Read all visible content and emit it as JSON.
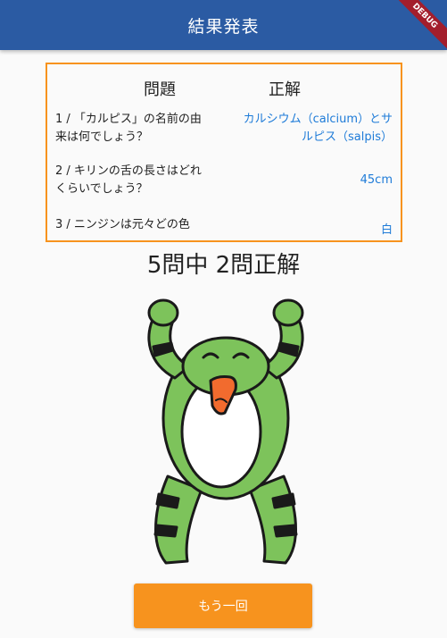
{
  "appbar": {
    "title": "結果発表",
    "debug_label": "DEBUG"
  },
  "results": {
    "header_question": "問題",
    "header_answer": "正解",
    "rows": [
      {
        "question": "1 / 「カルピス」の名前の由来は何でしょう？",
        "answer": "カルシウム（calcium）とサルピス（salpis）"
      },
      {
        "question": "2 / キリンの舌の長さはどれくらいでしょう？",
        "answer": "45cm"
      },
      {
        "question": "3 / ニンジンは元々どの色",
        "answer": "白"
      }
    ]
  },
  "score": "5問中 2問正解",
  "frog": {
    "icon": "cheering-frog-illustration"
  },
  "retry_button": {
    "label": "もう一回"
  },
  "colors": {
    "appbar": "#2b5ba3",
    "accent": "#f7931e",
    "answer_text": "#1e7bd8"
  }
}
